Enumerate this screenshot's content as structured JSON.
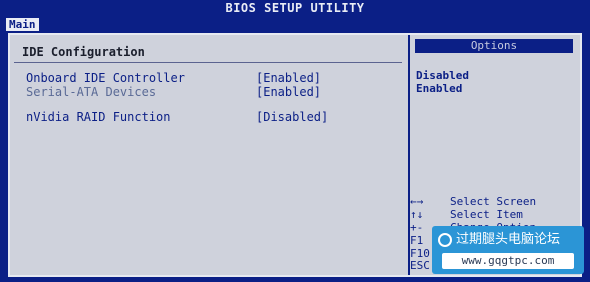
{
  "title": "BIOS SETUP UTILITY",
  "menu": {
    "main_tab": "Main"
  },
  "main": {
    "heading": "IDE Configuration",
    "rows": [
      {
        "label": "Onboard IDE Controller",
        "value": "[Enabled]"
      },
      {
        "label": "Serial-ATA Devices",
        "value": "[Enabled]"
      },
      {
        "label": "nVidia RAID Function",
        "value": "[Disabled]"
      }
    ]
  },
  "options": {
    "heading": "Options",
    "items": [
      "Disabled",
      "Enabled"
    ]
  },
  "help": [
    {
      "key": "←→",
      "desc": "Select Screen"
    },
    {
      "key": "↑↓",
      "desc": "Select Item"
    },
    {
      "key": "+-",
      "desc": "Change Option"
    },
    {
      "key": "F1",
      "desc": ""
    },
    {
      "key": "F10",
      "desc": ""
    },
    {
      "key": "ESC",
      "desc": ""
    }
  ],
  "watermark": {
    "text": "过期腿头电脑论坛",
    "url": "www.gqgtpc.com"
  },
  "colors": {
    "background": "#0b1f86",
    "panel": "#cfd2dc",
    "text": "#0b1f86"
  }
}
